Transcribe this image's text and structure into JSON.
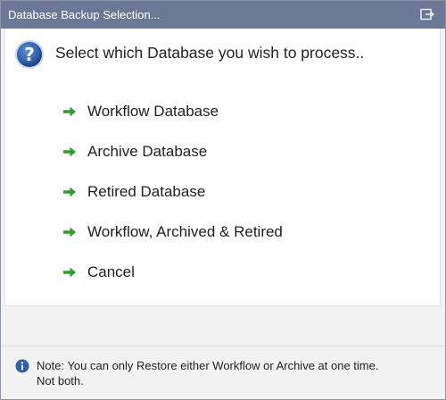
{
  "window": {
    "title": "Database Backup Selection..."
  },
  "prompt": {
    "heading": "Select which Database you wish to process.."
  },
  "options": [
    {
      "label": "Workflow Database"
    },
    {
      "label": "Archive Database"
    },
    {
      "label": "Retired Database"
    },
    {
      "label": "Workflow, Archived & Retired"
    },
    {
      "label": "Cancel"
    }
  ],
  "note": {
    "line1": "Note:  You can only Restore either Workflow or Archive at one time.",
    "line2": "Not both."
  },
  "icons": {
    "title_action": "exit-icon",
    "prompt": "question-icon",
    "option_marker": "green-arrow-icon",
    "note": "info-icon"
  },
  "colors": {
    "titlebar": "#6b7896",
    "arrow_green": "#2e9e2e",
    "question_blue": "#2f5fa8"
  }
}
